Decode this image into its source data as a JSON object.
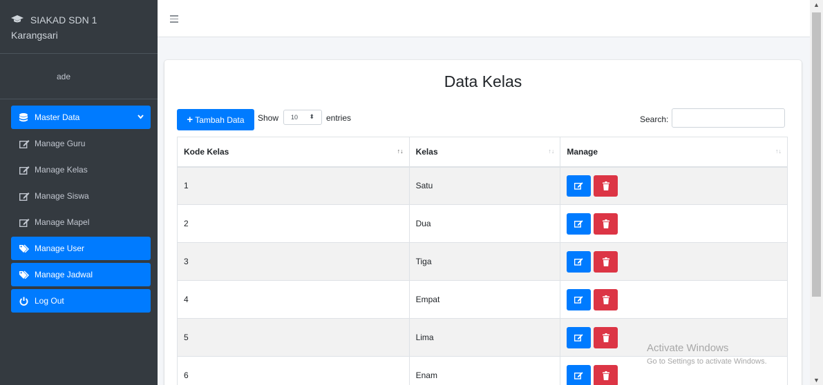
{
  "brand": {
    "line1": "SIAKAD SDN 1",
    "line2": "Karangsari"
  },
  "user": {
    "name": "ade"
  },
  "menu": {
    "master_data": "Master Data",
    "items": [
      "Manage Guru",
      "Manage Kelas",
      "Manage Siswa",
      "Manage Mapel"
    ],
    "manage_user": "Manage User",
    "manage_jadwal": "Manage Jadwal",
    "logout": "Log Out"
  },
  "card": {
    "title": "Data Kelas"
  },
  "toolbar": {
    "add_label": "Tambah Data",
    "show_label": "Show",
    "entries_value": "10",
    "entries_label": "entries",
    "search_label": "Search:"
  },
  "table": {
    "headers": [
      "Kode Kelas",
      "Kelas",
      "Manage"
    ],
    "rows": [
      {
        "kode": "1",
        "kelas": "Satu"
      },
      {
        "kode": "2",
        "kelas": "Dua"
      },
      {
        "kode": "3",
        "kelas": "Tiga"
      },
      {
        "kode": "4",
        "kelas": "Empat"
      },
      {
        "kode": "5",
        "kelas": "Lima"
      },
      {
        "kode": "6",
        "kelas": "Enam"
      }
    ]
  },
  "watermark": {
    "line1": "Activate Windows",
    "line2": "Go to Settings to activate Windows."
  },
  "colors": {
    "sidebar": "#343a40",
    "primary": "#007bff",
    "danger": "#dc3545"
  },
  "icons": {
    "brand": "graduation-cap-icon",
    "master": "database-icon",
    "edit": "edit-icon",
    "tag": "tag-icon",
    "power": "power-icon",
    "delete": "trash-icon"
  }
}
